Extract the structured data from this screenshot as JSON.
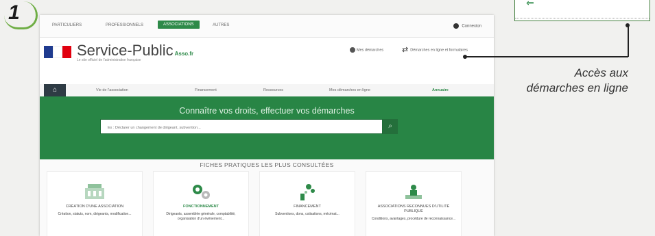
{
  "step_number": "1",
  "callout": {
    "line1": "Accès aux",
    "line2": "démarches en ligne"
  },
  "top_nav": {
    "items": [
      "PARTICULIERS",
      "PROFESSIONNELS",
      "ASSOCIATIONS",
      "AUTRES"
    ],
    "active_index": 2,
    "account": "Connexion"
  },
  "header": {
    "site_title": "Service-Public",
    "site_title_accent": "Asso.fr",
    "site_subtitle": "Le site officiel de l'administration française",
    "link1": "Mes démarches",
    "link2": "Démarches en ligne et formulaires"
  },
  "main_nav": {
    "items": [
      "Vie de l'association",
      "Financement",
      "Ressources",
      "Mes démarches en ligne",
      "Annuaire"
    ]
  },
  "hero": {
    "title": "Connaître vos droits, effectuer vos démarches",
    "search_placeholder": "Ex : Déclarer un changement de dirigeant, subvention..."
  },
  "fiches": {
    "title": "FICHES PRATIQUES LES PLUS CONSULTÉES",
    "cards": [
      {
        "title": "CRÉATION D'UNE ASSOCIATION",
        "desc": "Création, statuts, nom, dirigeants, modification..."
      },
      {
        "title": "FONCTIONNEMENT",
        "desc": "Dirigeants, assemblée générale, comptabilité, organisation d'un événement..."
      },
      {
        "title": "FINANCEMENT",
        "desc": "Subventions, dons, cotisations, mécénat..."
      },
      {
        "title": "ASSOCIATIONS RECONNUES D'UTILITÉ PUBLIQUE",
        "desc": "Conditions, avantages, procédure de reconnaissance..."
      }
    ]
  },
  "colors": {
    "brand_green": "#288545",
    "accent_green": "#2e8a49",
    "nav_dark": "#2e3b44"
  }
}
